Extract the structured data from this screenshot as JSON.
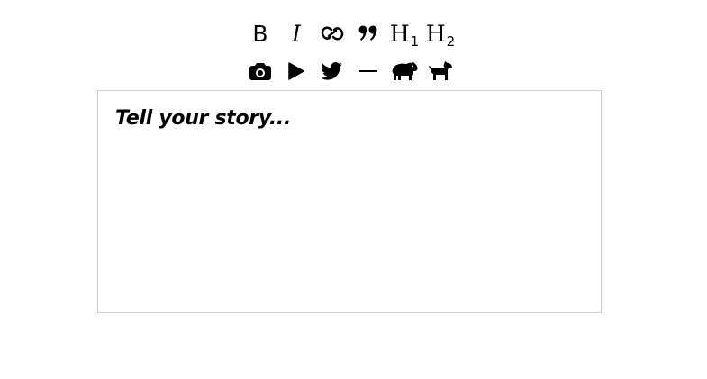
{
  "toolbar": {
    "bold_label": "B",
    "italic_label": "I",
    "h1_main": "H",
    "h1_sub": "1",
    "h2_main": "H",
    "h2_sub": "2",
    "icons": [
      "bold-icon",
      "italic-icon",
      "link-icon",
      "quote-icon",
      "heading-1-icon",
      "heading-2-icon",
      "camera-icon",
      "play-icon",
      "twitter-icon",
      "divider-icon",
      "hippo-icon",
      "dog-icon"
    ]
  },
  "editor": {
    "placeholder": "Tell your story..."
  }
}
